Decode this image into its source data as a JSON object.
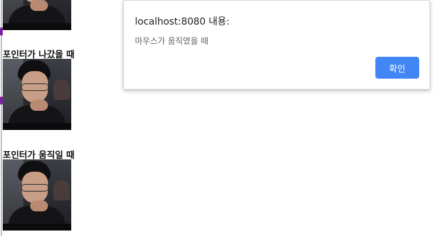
{
  "sections": {
    "pointer_out_label": "포인터가 나갔을 때",
    "pointer_move_label": "포인터가 움직일 때"
  },
  "alert": {
    "title": "localhost:8080 내용:",
    "message": "마우스가 움직였을 때",
    "ok_label": "확인"
  },
  "colors": {
    "accent_button": "#4285f4",
    "edge_marker": "#7b1fa2"
  }
}
